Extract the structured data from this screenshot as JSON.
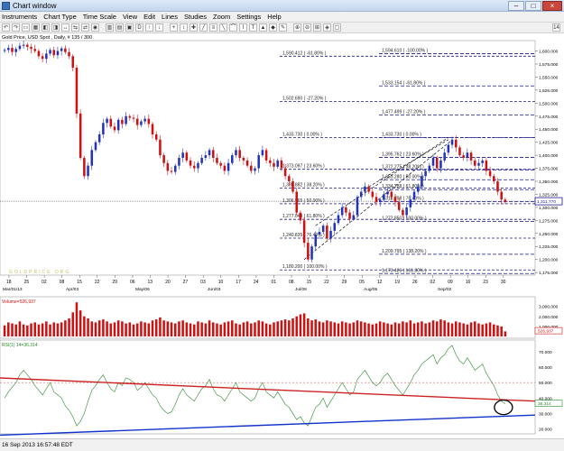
{
  "window": {
    "title": "Chart window",
    "close_symbol": "×"
  },
  "menu": [
    "Instruments",
    "Chart Type",
    "Time Scale",
    "View",
    "Edit",
    "Lines",
    "Studies",
    "Zoom",
    "Settings",
    "Help"
  ],
  "chart_header": "Gold Price, USD Spot , Daily, # 135 / 300",
  "status": "16 Sep 2013 16:57:48 EDT",
  "colors": {
    "bull": "#2233bb",
    "bear": "#cc1111",
    "fib": "#1a1a8a",
    "rsi": "#2a8a2a",
    "trend_red": "#cc2222",
    "trend_blue": "#1133cc",
    "current_box": "#1a1a8a"
  },
  "price_axis": [
    "1,600.000",
    "1,575.000",
    "1,550.000",
    "1,525.000",
    "1,500.000",
    "1,475.000",
    "1,450.000",
    "1,425.000",
    "1,400.000",
    "1,375.000",
    "1,350.000",
    "1,325.000",
    "1,300.000",
    "1,275.000",
    "1,250.000",
    "1,225.000",
    "1,200.000",
    "1,175.000"
  ],
  "current_price": "1,311.770",
  "fib_left": [
    {
      "text": "1,590.412  ( -61.80% )",
      "price": 1590
    },
    {
      "text": "1,502.690  ( -27.20% )",
      "price": 1503
    },
    {
      "text": "1,433.730  ( 0.00% )",
      "price": 1434
    },
    {
      "text": "1,373.097  ( 23.60% )",
      "price": 1373
    },
    {
      "text": "1,336.882  ( 38.20% )",
      "price": 1337
    },
    {
      "text": "1,306.965  ( 50.00% )",
      "price": 1307
    },
    {
      "text": "1,277.049  ( 61.80% )",
      "price": 1277
    },
    {
      "text": "1,240.835  ( 76.40% )",
      "price": 1241
    },
    {
      "text": "1,180.200  ( 100.00% )",
      "price": 1180
    }
  ],
  "fib_right": [
    {
      "text": "1,594.610  ( -100.00% )",
      "price": 1595
    },
    {
      "text": "1,533.154  ( -61.80% )",
      "price": 1533
    },
    {
      "text": "1,477.499  ( -27.20% )",
      "price": 1477
    },
    {
      "text": "1,433.730  ( 0.00% )",
      "price": 1434
    },
    {
      "text": "1,395.762  ( 23.60% )",
      "price": 1396
    },
    {
      "text": "1,372.275  ( 38.20% )",
      "price": 1372
    },
    {
      "text": "1,353.280  ( 50.00% )",
      "price": 1353
    },
    {
      "text": "1,334.288  ( 61.80% )",
      "price": 1334
    },
    {
      "text": "1,310.798  ( 76.40% )",
      "price": 1311
    },
    {
      "text": "1,272.850  ( 100.00% )",
      "price": 1273
    },
    {
      "text": "1,209.795  ( 138.20% )",
      "price": 1210
    },
    {
      "text": "1,173.426  ( 161.80% )",
      "price": 1173
    }
  ],
  "date_ticks": [
    "18",
    "25",
    "02",
    "08",
    "15",
    "22",
    "29",
    "06",
    "13",
    "20",
    "27",
    "03",
    "10",
    "17",
    "24",
    "01",
    "08",
    "15",
    "22",
    "29",
    "05",
    "12",
    "19",
    "26",
    "02",
    "09",
    "16",
    "23",
    "30"
  ],
  "month_labels": [
    "Mar/01/13",
    "Apr/03",
    "May/06",
    "Jun/03",
    "Jul/08",
    "Aug/05",
    "Sep/02"
  ],
  "volume": {
    "label": "Volume=526,937",
    "axis": [
      "3,000,000",
      "2,000,000",
      "1,000,000"
    ],
    "current": "526,937"
  },
  "rsi": {
    "label": "RSI(1) 14=36.314",
    "axis": [
      "70.000",
      "60.000",
      "50.000",
      "40.000",
      "30.000",
      "20.000"
    ],
    "current": "36.314"
  },
  "watermark": "GOLDPRICE.ORG",
  "chart_data": {
    "type": "candlestick",
    "title": "Gold Price, USD Spot , Daily, # 135 / 300",
    "ylim": [
      1170,
      1620
    ],
    "closes": [
      1602,
      1606,
      1598,
      1604,
      1610,
      1612,
      1608,
      1604,
      1600,
      1590,
      1585,
      1595,
      1602,
      1592,
      1600,
      1605,
      1598,
      1590,
      1568,
      1480,
      1395,
      1360,
      1380,
      1410,
      1425,
      1440,
      1462,
      1470,
      1455,
      1448,
      1468,
      1460,
      1475,
      1472,
      1470,
      1458,
      1465,
      1470,
      1460,
      1440,
      1430,
      1400,
      1385,
      1370,
      1368,
      1380,
      1395,
      1405,
      1390,
      1380,
      1375,
      1385,
      1395,
      1400,
      1410,
      1395,
      1385,
      1380,
      1370,
      1385,
      1400,
      1410,
      1395,
      1390,
      1380,
      1370,
      1375,
      1400,
      1410,
      1390,
      1385,
      1378,
      1390,
      1375,
      1360,
      1350,
      1330,
      1290,
      1275,
      1232,
      1200,
      1225,
      1248,
      1253,
      1265,
      1240,
      1255,
      1270,
      1285,
      1300,
      1290,
      1278,
      1285,
      1320,
      1330,
      1340,
      1330,
      1320,
      1310,
      1315,
      1325,
      1330,
      1320,
      1310,
      1295,
      1285,
      1300,
      1315,
      1330,
      1340,
      1360,
      1370,
      1380,
      1395,
      1375,
      1390,
      1405,
      1420,
      1430,
      1415,
      1400,
      1395,
      1405,
      1390,
      1380,
      1385,
      1390,
      1370,
      1360,
      1350,
      1330,
      1315,
      1310
    ],
    "volume": [
      1.1,
      1.4,
      1.3,
      1.2,
      1.5,
      1.2,
      1.1,
      1.3,
      1.4,
      1.2,
      1.3,
      1.5,
      1.2,
      1.4,
      1.3,
      1.4,
      1.6,
      1.8,
      2.4,
      3.4,
      2.6,
      2.0,
      1.8,
      1.5,
      1.4,
      1.6,
      1.7,
      1.5,
      1.3,
      1.4,
      1.6,
      1.5,
      1.3,
      1.4,
      1.2,
      1.3,
      1.5,
      1.4,
      1.3,
      1.6,
      1.7,
      1.9,
      1.6,
      1.5,
      1.4,
      1.3,
      1.5,
      1.6,
      1.4,
      1.3,
      1.2,
      1.5,
      1.4,
      1.3,
      1.6,
      1.4,
      1.3,
      1.2,
      1.4,
      1.5,
      1.6,
      1.3,
      1.2,
      1.4,
      1.5,
      1.3,
      1.4,
      1.6,
      1.5,
      1.3,
      1.2,
      1.4,
      1.5,
      1.6,
      1.7,
      1.6,
      1.8,
      2.0,
      2.2,
      2.3,
      1.8,
      1.6,
      1.7,
      1.5,
      1.4,
      1.6,
      1.5,
      1.4,
      1.3,
      1.5,
      1.4,
      1.3,
      1.4,
      1.6,
      1.5,
      1.4,
      1.3,
      1.2,
      1.3,
      1.5,
      1.4,
      1.3,
      1.2,
      1.4,
      1.3,
      1.5,
      1.4,
      1.6,
      1.3,
      1.4,
      1.5,
      1.3,
      1.4,
      1.6,
      1.5,
      1.7,
      1.6,
      1.4,
      1.3,
      1.5,
      1.4,
      1.3,
      1.2,
      1.4,
      1.5,
      1.3,
      1.2,
      1.3,
      1.4,
      1.2,
      1.1,
      1.0,
      0.5
    ],
    "rsi": [
      40,
      44,
      47,
      50,
      55,
      58,
      55,
      52,
      48,
      45,
      42,
      46,
      50,
      44,
      42,
      40,
      35,
      32,
      28,
      22,
      25,
      30,
      38,
      45,
      48,
      52,
      55,
      50,
      46,
      44,
      50,
      48,
      53,
      52,
      50,
      45,
      47,
      50,
      46,
      42,
      40,
      35,
      32,
      30,
      31,
      36,
      42,
      46,
      42,
      40,
      38,
      42,
      46,
      48,
      52,
      46,
      42,
      41,
      38,
      42,
      46,
      50,
      44,
      42,
      40,
      38,
      40,
      46,
      50,
      44,
      42,
      40,
      44,
      40,
      36,
      34,
      30,
      26,
      28,
      24,
      22,
      28,
      34,
      36,
      40,
      34,
      38,
      42,
      46,
      50,
      46,
      42,
      44,
      52,
      55,
      58,
      54,
      50,
      48,
      50,
      54,
      56,
      52,
      48,
      45,
      42,
      46,
      50,
      55,
      58,
      62,
      64,
      66,
      68,
      62,
      66,
      68,
      72,
      74,
      68,
      64,
      62,
      66,
      62,
      58,
      60,
      62,
      56,
      52,
      48,
      42,
      38,
      36.3
    ]
  }
}
